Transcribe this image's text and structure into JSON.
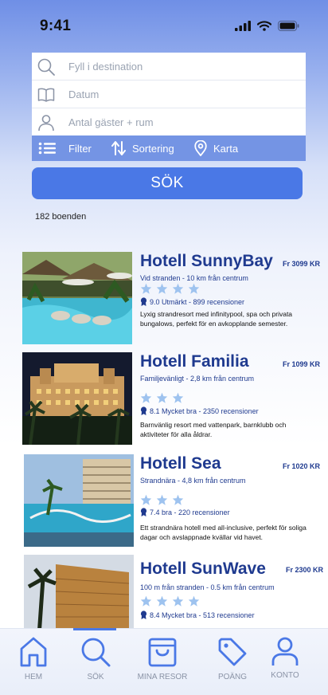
{
  "status_bar": {
    "time": "9:41"
  },
  "search": {
    "destination_placeholder": "Fyll i destination",
    "date_placeholder": "Datum",
    "guests_placeholder": "Antal gäster + rum"
  },
  "options": {
    "filter": "Filter",
    "sort": "Sortering",
    "map": "Karta"
  },
  "search_button": "SÖK",
  "results_count": "182 boenden",
  "hotels": [
    {
      "name": "Hotell SunnyBay",
      "price": "Fr 3099 KR",
      "location": "Vid stranden - 10 km från centrum",
      "stars": 4,
      "rating": "9.0 Utmärkt  - 899 recensioner",
      "description": "Lyxig strandresort med infinitypool, spa och privata bungalows, perfekt för en avkopplande semester."
    },
    {
      "name": "Hotell Familia",
      "price": "Fr 1099 KR",
      "location": "Familjevänligt - 2,8 km från centrum",
      "stars": 3,
      "rating": "8.1 Mycket bra - 2350 recensioner",
      "description": "Barnvänlig resort med vattenpark, barnklubb och aktiviteter för alla åldrar."
    },
    {
      "name": "Hotell Sea",
      "price": "Fr 1020 KR",
      "location": "Strandnära - 4,8 km från centrum",
      "stars": 3,
      "rating": "7.4 bra - 220 recensioner",
      "description": "Ett strandnära hotell med all-inclusive, perfekt för soliga dagar och avslappnade kvällar vid havet."
    },
    {
      "name": "Hotell SunWave",
      "price": "Fr 2300 KR",
      "location": "100 m från stranden - 0.5 km från centrum",
      "stars": 4,
      "rating": "8.4 Mycket bra - 513 recensioner",
      "description": ""
    }
  ],
  "nav": {
    "home": "HEM",
    "search": "SÖK",
    "trips": "MINA RESOR",
    "points": "POÄNG",
    "account": "KONTO"
  },
  "colors": {
    "accent": "#4a78e6",
    "brand_text": "#1f3a8f",
    "star": "#9ec3ef"
  }
}
